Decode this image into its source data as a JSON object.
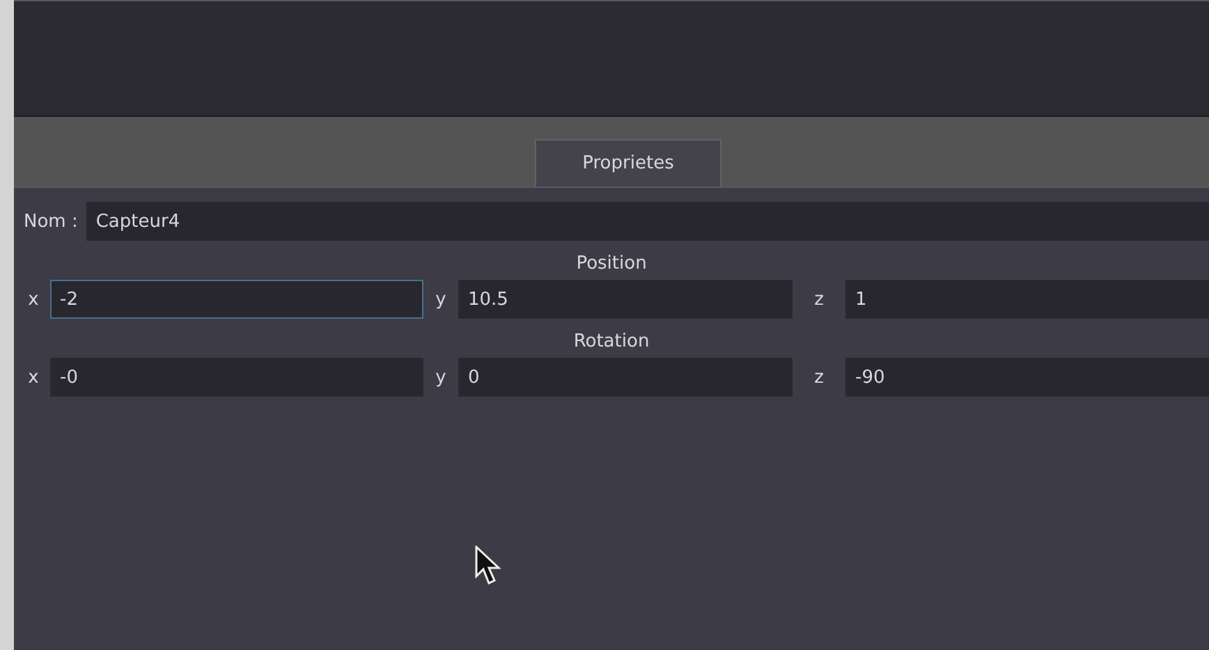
{
  "tabs": [
    {
      "label": "Proprietes",
      "selected": true
    }
  ],
  "name_field": {
    "label": "Nom :",
    "value": "Capteur4"
  },
  "groups": [
    {
      "title": "Position",
      "fields": [
        {
          "label": "x",
          "value": "-2",
          "focused": true
        },
        {
          "label": "y",
          "value": "10.5",
          "focused": false
        },
        {
          "label": "z",
          "value": "1",
          "focused": false
        }
      ]
    },
    {
      "title": "Rotation",
      "fields": [
        {
          "label": "x",
          "value": "-0",
          "focused": false
        },
        {
          "label": "y",
          "value": "0",
          "focused": false
        },
        {
          "label": "z",
          "value": "-90",
          "focused": false
        }
      ]
    }
  ]
}
